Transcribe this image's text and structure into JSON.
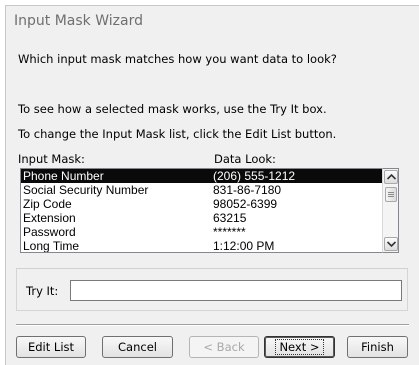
{
  "window": {
    "title": "Input Mask Wizard"
  },
  "prompt": "Which input mask matches how you want data to look?",
  "instruction1": "To see how a selected mask works, use the Try It box.",
  "instruction2": "To change the Input Mask list, click the Edit List button.",
  "columns": {
    "mask": "Input Mask:",
    "look": "Data Look:"
  },
  "masks": [
    {
      "name": "Phone Number",
      "look": "(206) 555-1212",
      "selected": true
    },
    {
      "name": "Social Security Number",
      "look": "831-86-7180",
      "selected": false
    },
    {
      "name": "Zip Code",
      "look": "98052-6399",
      "selected": false
    },
    {
      "name": "Extension",
      "look": "63215",
      "selected": false
    },
    {
      "name": "Password",
      "look": "*******",
      "selected": false
    },
    {
      "name": "Long Time",
      "look": "1:12:00 PM",
      "selected": false
    }
  ],
  "try_it": {
    "label": "Try It:",
    "value": ""
  },
  "buttons": {
    "edit_list": "Edit List",
    "cancel": "Cancel",
    "back": "< Back",
    "next": "Next >",
    "finish": "Finish"
  },
  "icons": {
    "scroll_up": "scroll-up-arrow-icon",
    "scroll_down": "scroll-down-arrow-icon"
  }
}
